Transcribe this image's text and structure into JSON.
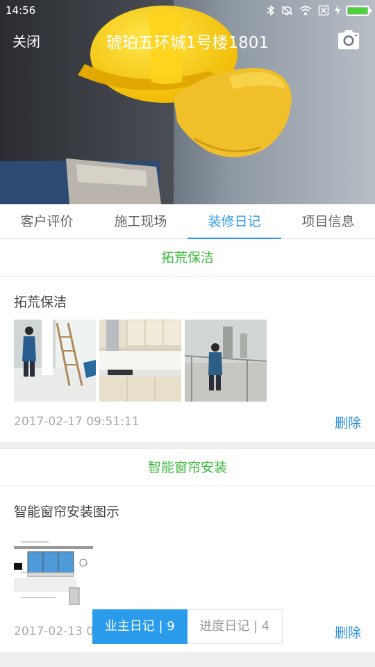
{
  "status_bar": {
    "time": "14:56"
  },
  "header": {
    "close_label": "关闭",
    "title": "琥珀五环城1号楼1801"
  },
  "tabs": [
    {
      "label": "客户评价"
    },
    {
      "label": "施工现场"
    },
    {
      "label": "装修日记",
      "active": true
    },
    {
      "label": "项目信息"
    }
  ],
  "entries": [
    {
      "section": "拓荒保洁",
      "title": "拓荒保洁",
      "time": "2017-02-17 09:51:11",
      "delete_label": "删除"
    },
    {
      "section": "智能窗帘安装",
      "title": "智能窗帘安装图示",
      "time": "2017-02-13 0",
      "delete_label": "删除"
    }
  ],
  "toggle": {
    "owner_label": "业主日记 | 9",
    "progress_label": "进度日记 | 4"
  },
  "colors": {
    "accent": "#2b9cec",
    "section_green": "#3cb93c",
    "delete_blue": "#2b8ee0",
    "battery_green": "#4cd137"
  }
}
